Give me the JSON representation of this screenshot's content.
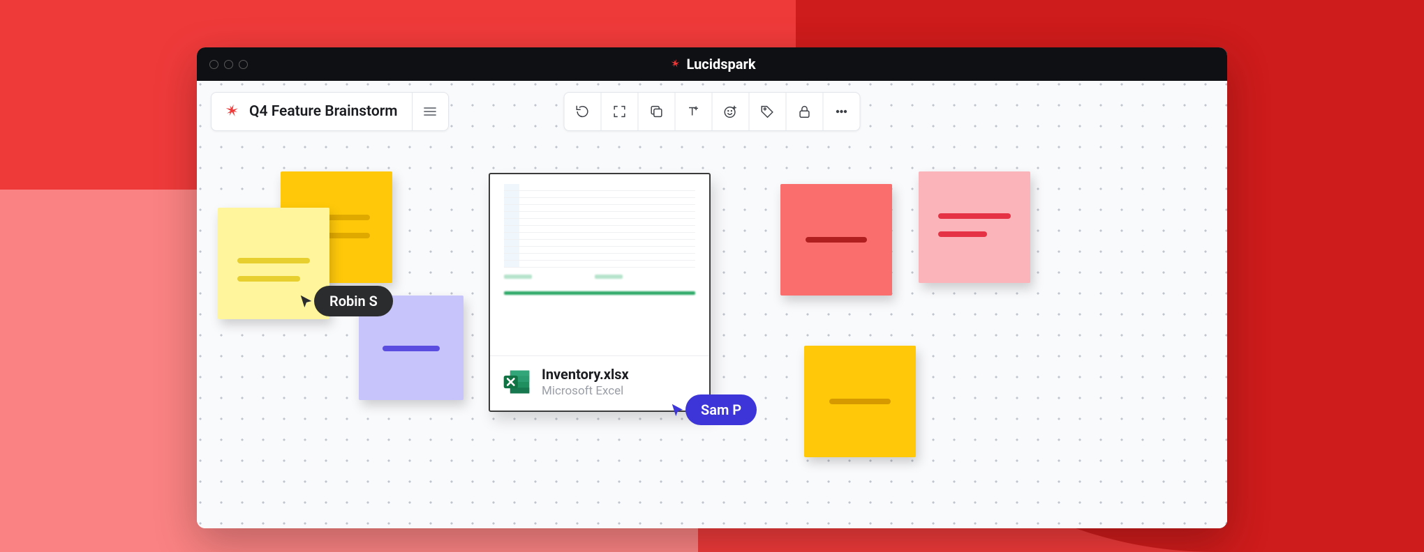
{
  "app": {
    "name": "Lucidspark"
  },
  "document": {
    "title": "Q4 Feature Brainstorm"
  },
  "toolbar": {
    "items": [
      {
        "name": "rotate-ccw-icon"
      },
      {
        "name": "expand-icon"
      },
      {
        "name": "copy-icon"
      },
      {
        "name": "text-add-icon"
      },
      {
        "name": "emoji-add-icon"
      },
      {
        "name": "tag-icon"
      },
      {
        "name": "lock-icon"
      },
      {
        "name": "more-icon"
      }
    ]
  },
  "collaborators": {
    "robin": {
      "label": "Robin S",
      "color": "#2b2c2e"
    },
    "sam": {
      "label": "Sam P",
      "color": "#3d35d8"
    }
  },
  "embedded_file": {
    "filename": "Inventory.xlsx",
    "filetype": "Microsoft Excel"
  },
  "stickies": {
    "yellow_a": {
      "color": "#ffc909",
      "lines": [
        "#e0a900",
        "#e0a900"
      ]
    },
    "yellow_b": {
      "color": "#fff59c",
      "lines": [
        "#e6cf2f",
        "#e6cf2f"
      ]
    },
    "purple": {
      "color": "#c7c4fb",
      "lines": [
        "#5b4de0"
      ]
    },
    "red": {
      "color": "#fa6e6e",
      "lines": [
        "#b01f1f"
      ]
    },
    "pink": {
      "color": "#fbb4b9",
      "lines": [
        "#e53244",
        "#e53244"
      ]
    },
    "gold": {
      "color": "#ffc909",
      "lines": [
        "#d69a00"
      ]
    }
  }
}
